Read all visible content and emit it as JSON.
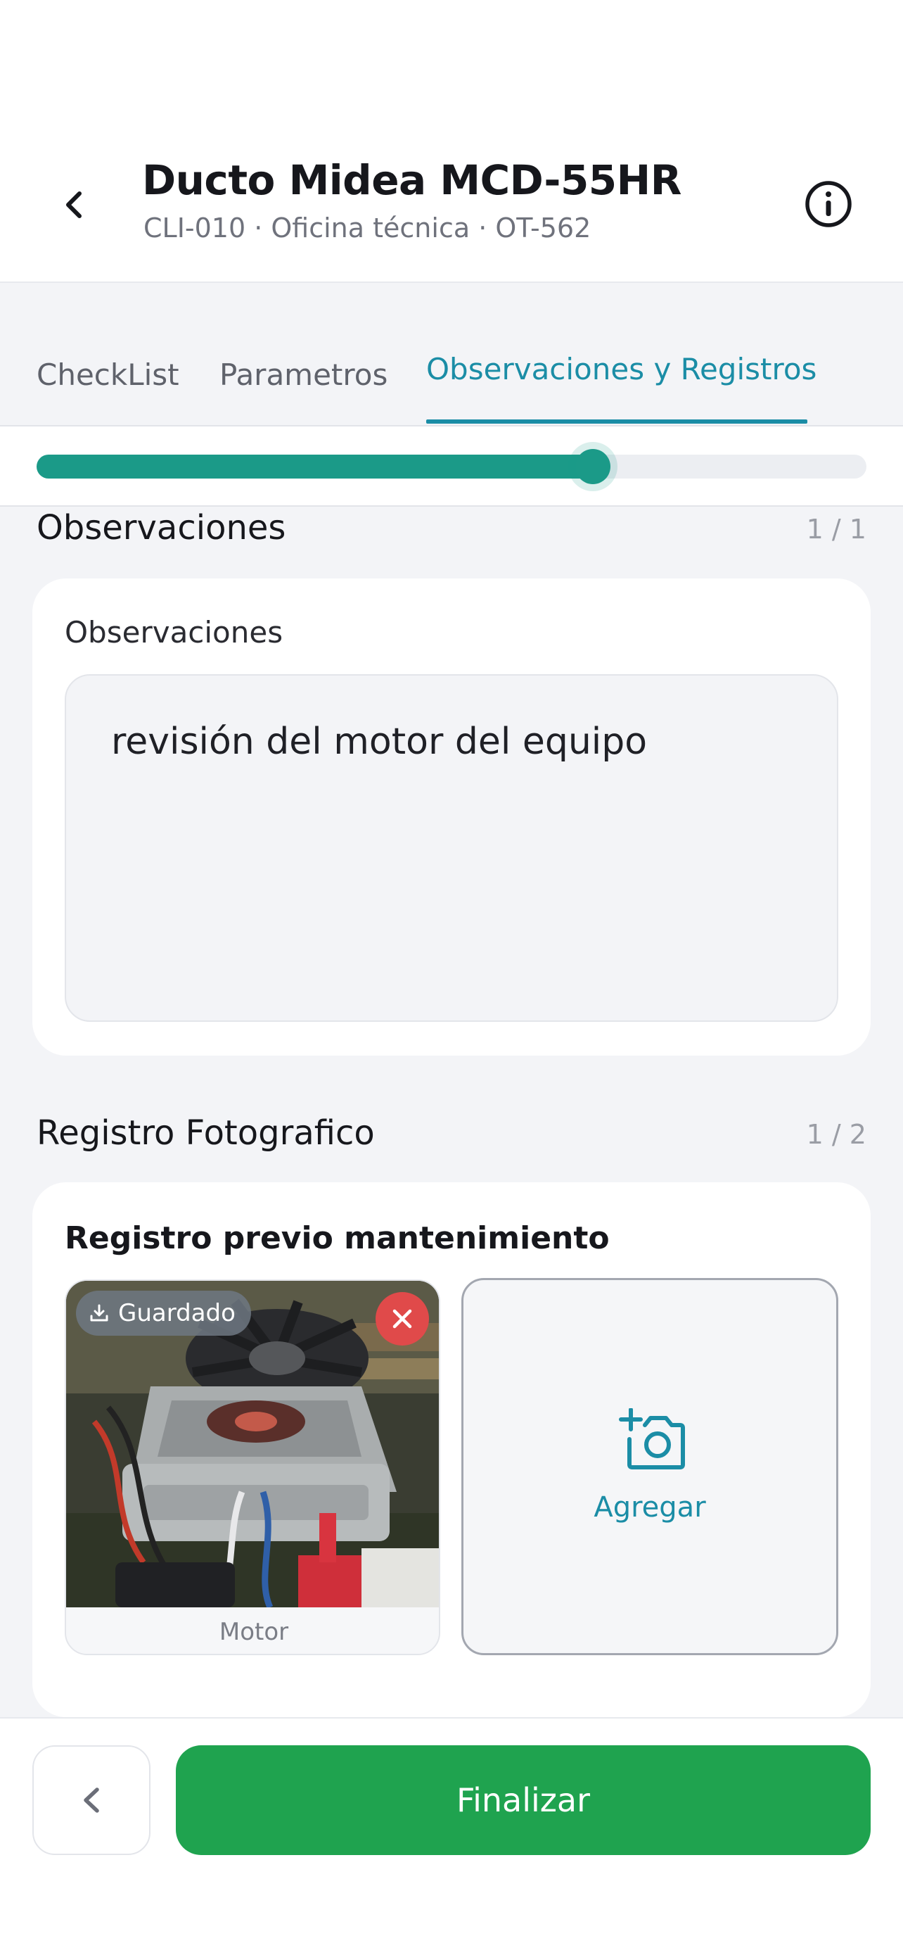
{
  "header": {
    "title": "Ducto Midea MCD-55HR",
    "subtitle": "CLI-010 · Oficina técnica · OT-562",
    "back_icon": "chevron-left-icon",
    "info_icon": "info-circle-icon"
  },
  "tabs": [
    {
      "label": "CheckList",
      "active": false
    },
    {
      "label": "Parametros",
      "active": false
    },
    {
      "label": "Observaciones y Registros",
      "active": true
    }
  ],
  "progress": {
    "value": 0.67,
    "color": "#1b9a88"
  },
  "observaciones": {
    "section_title": "Observaciones",
    "count": "1 / 1",
    "field_label": "Observaciones",
    "value": "revisión del motor del equipo"
  },
  "registro": {
    "section_title": "Registro Fotografico",
    "count": "1 / 2",
    "card_title": "Registro previo mantenimiento",
    "photos": [
      {
        "caption": "Motor",
        "badge": "Guardado",
        "badge_icon": "download-icon",
        "remove_icon": "close-icon"
      }
    ],
    "add_label": "Agregar",
    "add_icon": "add-photo-icon"
  },
  "footer": {
    "prev_icon": "chevron-left-icon",
    "finish_label": "Finalizar"
  },
  "colors": {
    "accent": "#1b8da6",
    "primary_button": "#1fa34f",
    "danger": "#e04a4a"
  }
}
